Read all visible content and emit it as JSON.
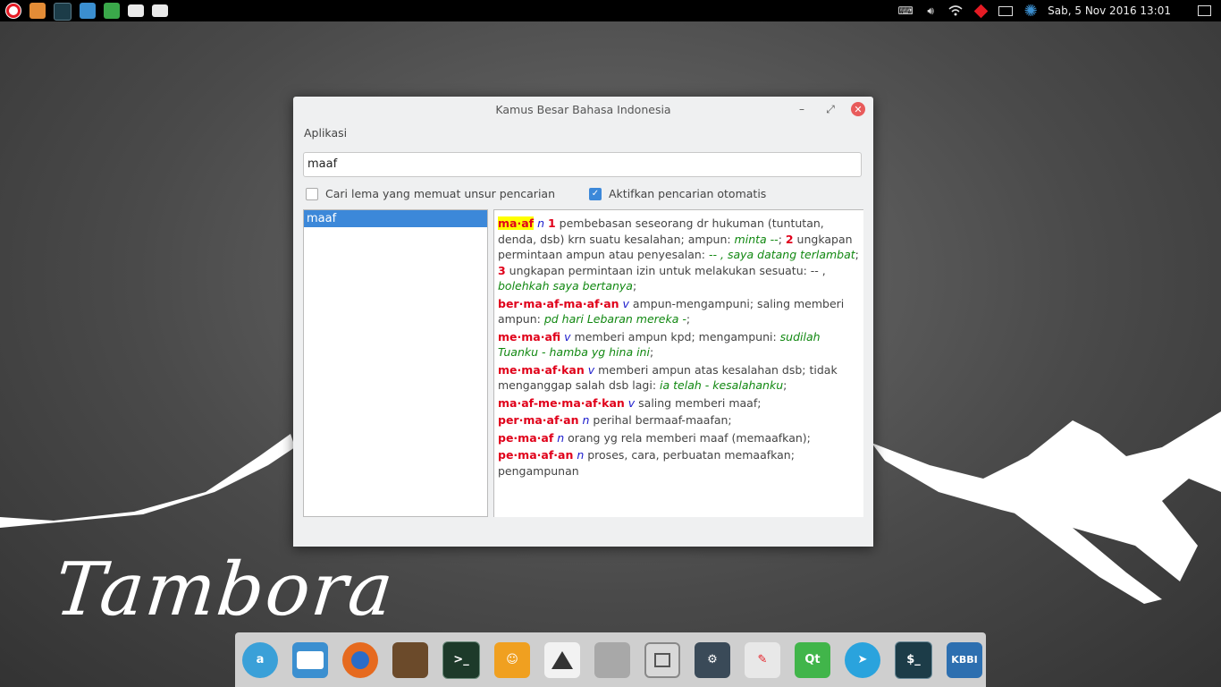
{
  "top_panel": {
    "launchers": [
      {
        "icon": "opera-icon",
        "color": "#e51b24"
      },
      {
        "icon": "app-icon",
        "color": "#e38c36"
      },
      {
        "icon": "terminal-icon",
        "color": "#1c3c48"
      },
      {
        "icon": "monitor-icon",
        "color": "#3b8fd0"
      },
      {
        "icon": "spreadsheet-icon",
        "color": "#3aa84a"
      },
      {
        "icon": "folder-icon",
        "color": "#e9e9e9"
      },
      {
        "icon": "folder-icon",
        "color": "#e9e9e9"
      }
    ],
    "clock": "Sab,  5 Nov 2016 13:01"
  },
  "wallpaper": {
    "brand": "Tambora"
  },
  "window": {
    "title": "Kamus Besar Bahasa Indonesia",
    "menu": "Aplikasi",
    "search_value": "maaf",
    "option1_label": "Cari lema yang memuat unsur pencarian",
    "option1_checked": false,
    "option2_label": "Aktifkan pencarian otomatis",
    "option2_checked": true,
    "results": [
      "maaf"
    ],
    "definition": {
      "e1": {
        "hw": "ma·af",
        "pos": "n",
        "n1": "1",
        "t1": " pembebasan seseorang dr hukuman (tuntutan, denda, dsb) krn suatu kesalahan; ampun: ",
        "x1": "minta --",
        "t1b": "; ",
        "n2": "2",
        "t2": " ungkapan permintaan ampun atau penyesalan: ",
        "x2": "-- , saya datang terlambat",
        "t2b": "; ",
        "n3": "3",
        "t3": " ungkapan permintaan izin untuk melakukan sesuatu: -- , ",
        "x3": "bolehkah saya bertanya",
        "t3b": ";"
      },
      "e2": {
        "hw": "ber·ma·af-ma·af·an",
        "pos": "v",
        "t": " ampun-mengampuni; saling memberi ampun: ",
        "x": "pd hari Lebaran mereka -",
        "tb": ";"
      },
      "e3": {
        "hw": "me·ma·afi",
        "pos": "v",
        "t": " memberi ampun kpd; mengampuni: ",
        "x": "sudilah Tuanku - hamba yg hina ini",
        "tb": ";"
      },
      "e4": {
        "hw": "me·ma·af·kan",
        "pos": "v",
        "t": " memberi ampun atas kesalahan dsb; tidak menganggap salah dsb lagi: ",
        "x": "ia telah - kesalahanku",
        "tb": ";"
      },
      "e5": {
        "hw": "ma·af-me·ma·af·kan",
        "pos": "v",
        "t": " saling memberi maaf;"
      },
      "e6": {
        "hw": "per·ma·af·an",
        "pos": "n",
        "t": " perihal bermaaf-maafan;"
      },
      "e7": {
        "hw": "pe·ma·af",
        "pos": "n",
        "t": " orang yg rela memberi maaf (memaafkan);"
      },
      "e8": {
        "hw": "pe·ma·af·an",
        "pos": "n",
        "t": " proses, cara, perbuatan memaafkan; pengampunan"
      }
    }
  },
  "dock": {
    "items": [
      {
        "icon": "app-store-icon",
        "label": "a",
        "color": "#3aa0d8"
      },
      {
        "icon": "file-manager-icon",
        "label": "",
        "color": "#3b8fd0"
      },
      {
        "icon": "firefox-icon",
        "label": "",
        "color": "#e66a1f"
      },
      {
        "icon": "image-editor-icon",
        "label": "",
        "color": "#6b4a2a"
      },
      {
        "icon": "terminal-icon",
        "label": ">_",
        "color": "#1d3a2a"
      },
      {
        "icon": "messenger-icon",
        "label": "",
        "color": "#f0a020"
      },
      {
        "icon": "inkscape-icon",
        "label": "",
        "color": "#f2f2f2"
      },
      {
        "icon": "document-icon",
        "label": "",
        "color": "#a8a8a8"
      },
      {
        "icon": "window-icon",
        "label": "",
        "color": "#d8d8d8"
      },
      {
        "icon": "settings-icon",
        "label": "",
        "color": "#3a4a58"
      },
      {
        "icon": "text-editor-icon",
        "label": "",
        "color": "#e8e8e8"
      },
      {
        "icon": "qt-creator-icon",
        "label": "Qt",
        "color": "#41b54a"
      },
      {
        "icon": "telegram-icon",
        "label": "",
        "color": "#2aa3dd"
      },
      {
        "icon": "terminal-icon",
        "label": "$_",
        "color": "#1c3c48"
      },
      {
        "icon": "kbbi-icon",
        "label": "KBBI",
        "color": "#2d6fb0"
      }
    ]
  }
}
